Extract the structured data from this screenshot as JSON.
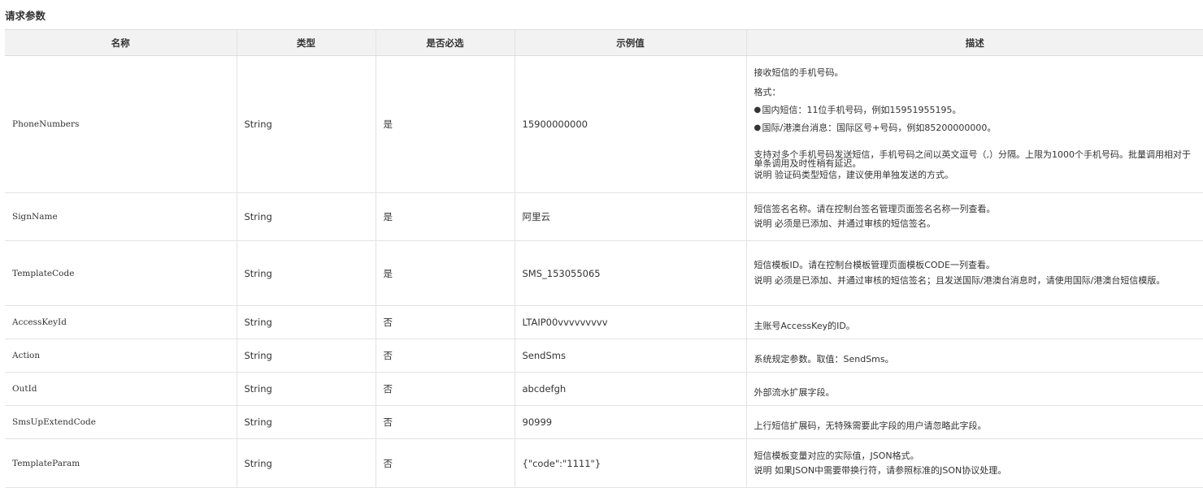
{
  "section_title": "请求参数",
  "columns": [
    "名称",
    "类型",
    "是否必选",
    "示例值",
    "描述"
  ],
  "rows": [
    {
      "name": "PhoneNumbers",
      "type": "String",
      "required": "是",
      "example": "15900000000",
      "desc": {
        "line1": "接收短信的手机号码。",
        "format_label": "格式：",
        "bullets": [
          "国内短信：11位手机号码，例如15951955195。",
          "国际/港澳台消息：国际区号+号码，例如85200000000。"
        ],
        "para": "支持对多个手机号码发送短信，手机号码之间以英文逗号（,）分隔。上限为1000个手机号码。批量调用相对于单条调用及时性稍有延迟。",
        "note": "说明 验证码类型短信，建议使用单独发送的方式。"
      }
    },
    {
      "name": "SignName",
      "type": "String",
      "required": "是",
      "example": "阿里云",
      "desc": {
        "line1": "短信签名名称。请在控制台签名管理页面签名名称一列查看。",
        "note": "说明 必须是已添加、并通过审核的短信签名。"
      }
    },
    {
      "name": "TemplateCode",
      "type": "String",
      "required": "是",
      "example": "SMS_153055065",
      "desc": {
        "line1": "短信模板ID。请在控制台模板管理页面模板CODE一列查看。",
        "note": "说明 必须是已添加、并通过审核的短信签名；且发送国际/港澳台消息时，请使用国际/港澳台短信模版。"
      }
    },
    {
      "name": "AccessKeyId",
      "type": "String",
      "required": "否",
      "example": "LTAIP00vvvvvvvvv",
      "desc": {
        "line1": "主账号AccessKey的ID。"
      }
    },
    {
      "name": "Action",
      "type": "String",
      "required": "否",
      "example": "SendSms",
      "desc": {
        "line1": "系统规定参数。取值：SendSms。"
      }
    },
    {
      "name": "OutId",
      "type": "String",
      "required": "否",
      "example": "abcdefgh",
      "desc": {
        "line1": "外部流水扩展字段。"
      }
    },
    {
      "name": "SmsUpExtendCode",
      "type": "String",
      "required": "否",
      "example": "90999",
      "desc": {
        "line1": "上行短信扩展码，无特殊需要此字段的用户请忽略此字段。"
      }
    },
    {
      "name": "TemplateParam",
      "type": "String",
      "required": "否",
      "example": "{\"code\":\"1111\"}",
      "desc": {
        "line1": "短信模板变量对应的实际值，JSON格式。",
        "note": "说明 如果JSON中需要带换行符，请参照标准的JSON协议处理。"
      }
    }
  ]
}
